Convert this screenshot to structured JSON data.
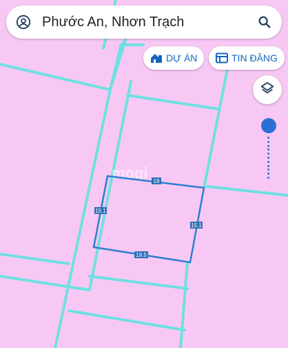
{
  "search": {
    "value": "Phước An, Nhơn Trạch"
  },
  "chips": {
    "du_an": "DỰ ÁN",
    "tin_dang": "TIN ĐĂNG"
  },
  "plot": {
    "top": "19",
    "left": "15.1",
    "right": "15.1",
    "bottom": "19.5"
  },
  "watermark": "mogi",
  "colors": {
    "map_bg": "#f8c8f5",
    "parcel": "#6fe0e0",
    "plot": "#2a7fcf",
    "accent": "#1565c0"
  },
  "icons": [
    "account-circle-icon",
    "search-icon",
    "project-house-icon",
    "listing-board-icon",
    "layers-icon"
  ]
}
